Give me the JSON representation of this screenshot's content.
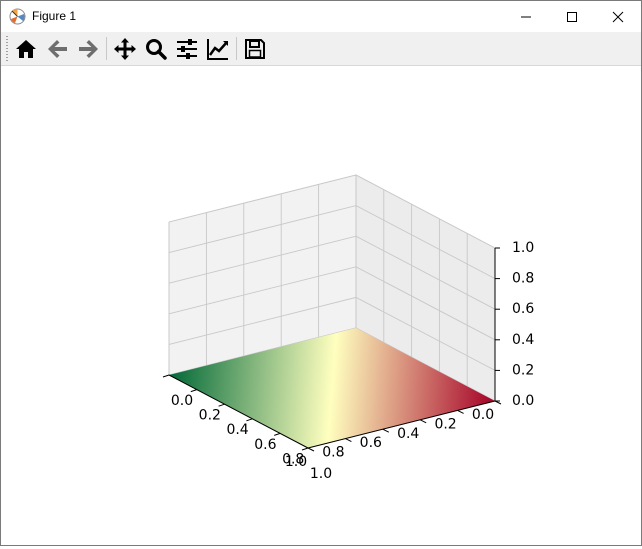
{
  "window": {
    "title": "Figure 1",
    "icon": "matplotlib-icon",
    "controls": [
      "minimize-icon",
      "maximize-icon",
      "close-icon"
    ]
  },
  "toolbar": {
    "buttons": [
      {
        "name": "home-button",
        "icon": "home-icon"
      },
      {
        "name": "back-button",
        "icon": "arrow-left-icon"
      },
      {
        "name": "forward-button",
        "icon": "arrow-right-icon"
      },
      {
        "name": "pan-button",
        "icon": "move-icon"
      },
      {
        "name": "zoom-button",
        "icon": "magnifier-icon"
      },
      {
        "name": "subplots-button",
        "icon": "sliders-icon"
      },
      {
        "name": "customize-button",
        "icon": "line-chart-icon"
      },
      {
        "name": "save-button",
        "icon": "floppy-disk-icon"
      }
    ]
  },
  "chart_data": {
    "type": "surface3d",
    "title": "",
    "xlabel": "",
    "ylabel": "",
    "zlabel": "",
    "xlim": [
      0.0,
      1.0
    ],
    "ylim": [
      0.0,
      1.0
    ],
    "zlim": [
      0.0,
      1.0
    ],
    "x_ticks": [
      "0.0",
      "0.2",
      "0.4",
      "0.6",
      "0.8",
      "1.0"
    ],
    "y_ticks": [
      "0.0",
      "0.2",
      "0.4",
      "0.6",
      "0.8",
      "1.0"
    ],
    "z_ticks": [
      "0.0",
      "0.2",
      "0.4",
      "0.6",
      "0.8",
      "1.0"
    ],
    "surface": {
      "colormap": "RdYlGn",
      "z_constant": 0.0,
      "color_low": "#006837",
      "color_mid": "#ffffbf",
      "color_high": "#a50026"
    },
    "grid": true
  }
}
